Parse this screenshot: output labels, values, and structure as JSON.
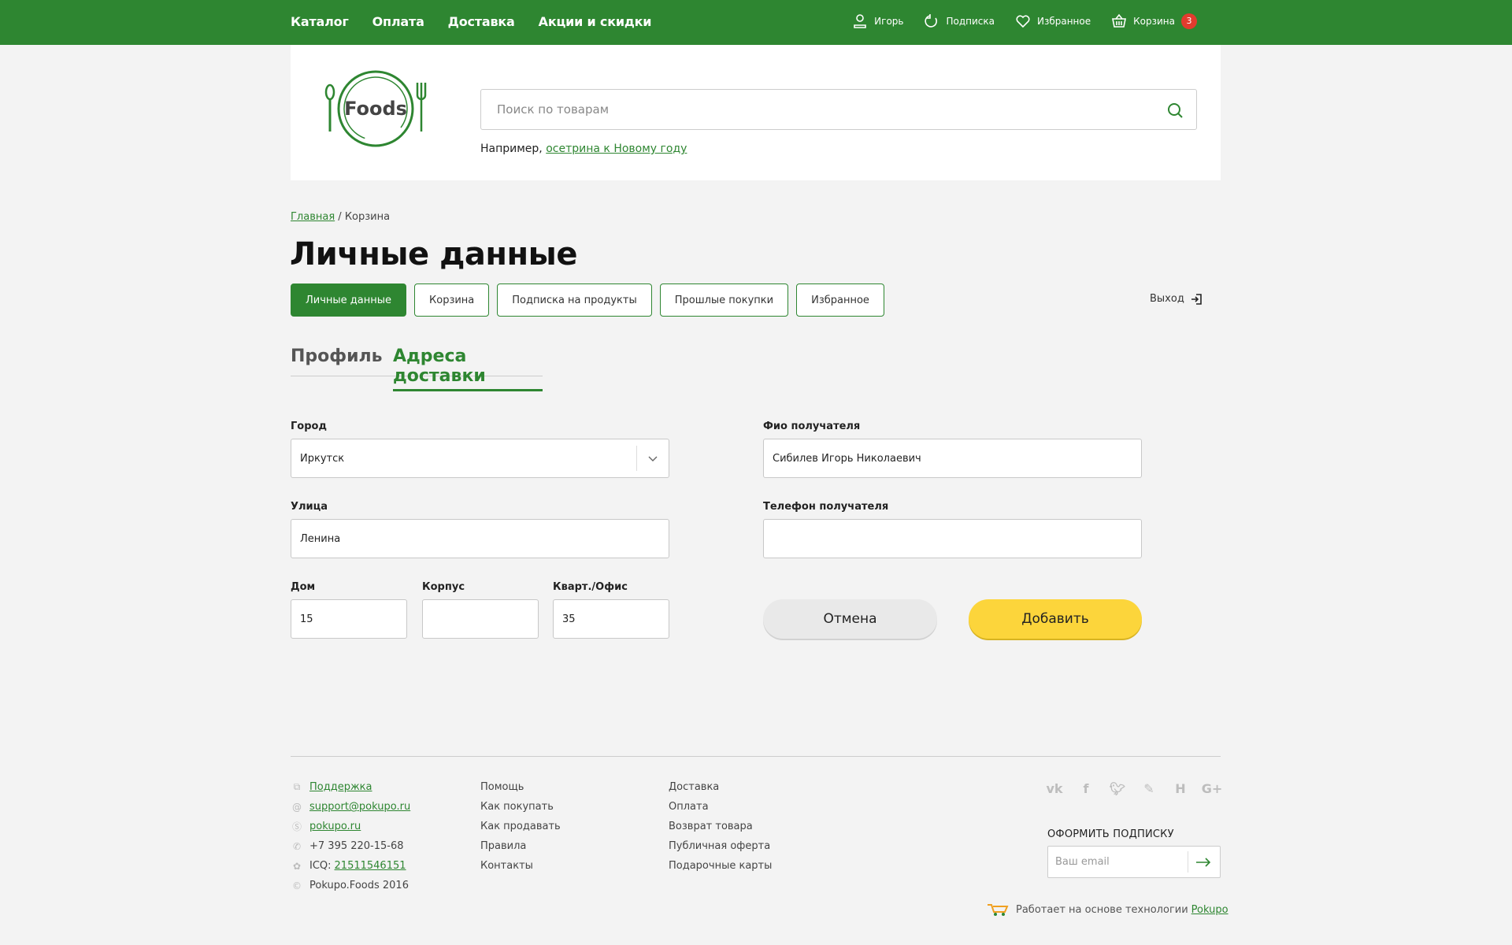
{
  "topnav": {
    "items": [
      {
        "label": "Каталог"
      },
      {
        "label": "Оплата"
      },
      {
        "label": "Доставка"
      },
      {
        "label": "Акции и скидки"
      }
    ]
  },
  "userbar": {
    "user_label": "Игорь",
    "subscription_label": "Подписка",
    "favorites_label": "Избранное",
    "cart_label": "Корзина",
    "cart_count": "3"
  },
  "header": {
    "logo_text": "Foods",
    "search_placeholder": "Поиск по товарам",
    "example_prefix": "Например,",
    "example_link": "осетрина к Новому году"
  },
  "breadcrumb": {
    "home": "Главная",
    "separator": "/",
    "current": "Корзина"
  },
  "page_title": "Личные данные",
  "account_tabs": [
    {
      "label": "Личные данные",
      "active": true
    },
    {
      "label": "Корзина"
    },
    {
      "label": "Подписка на продукты"
    },
    {
      "label": "Прошлые покупки"
    },
    {
      "label": "Избранное"
    }
  ],
  "logout_label": "Выход",
  "subtabs": {
    "profile": "Профиль",
    "addresses": "Адреса доставки"
  },
  "form": {
    "city_label": "Город",
    "city_value": "Иркутск",
    "street_label": "Улица",
    "street_value": "Ленина",
    "house_label": "Дом",
    "house_value": "15",
    "building_label": "Корпус",
    "building_value": "",
    "apartment_label": "Кварт./Офис",
    "apartment_value": "35",
    "recipient_label": "Фио получателя",
    "recipient_value": "Сибилев Игорь Николаевич",
    "phone_label": "Телефон получателя",
    "phone_value": "",
    "cancel_label": "Отмена",
    "add_label": "Добавить"
  },
  "footer": {
    "contacts": {
      "support": "Поддержка",
      "email": "support@pokupo.ru",
      "skype": "pokupo.ru",
      "phone": "+7 395 220-15-68",
      "icq_prefix": "ICQ:",
      "icq": "21511546151",
      "copyright": "Pokupo.Foods 2016"
    },
    "col2": [
      "Помощь",
      "Как покупать",
      "Как продавать",
      "Правила",
      "Контакты"
    ],
    "col3": [
      "Доставка",
      "Оплата",
      "Возврат товара",
      "Публичная оферта",
      "Подарочные карты"
    ],
    "social_icons": [
      "vk-icon",
      "facebook-icon",
      "twitter-icon",
      "livejournal-icon",
      "habr-icon",
      "google-plus-icon"
    ],
    "subscribe_title": "ОФОРМИТЬ ПОДПИСКУ",
    "subscribe_placeholder": "Ваш email",
    "powered_text": "Работает на основе технологии",
    "powered_link": "Pokupo"
  },
  "colors": {
    "brand_green": "#2e8631",
    "accent_yellow": "#fcd53b",
    "badge_red": "#e23b2e"
  }
}
